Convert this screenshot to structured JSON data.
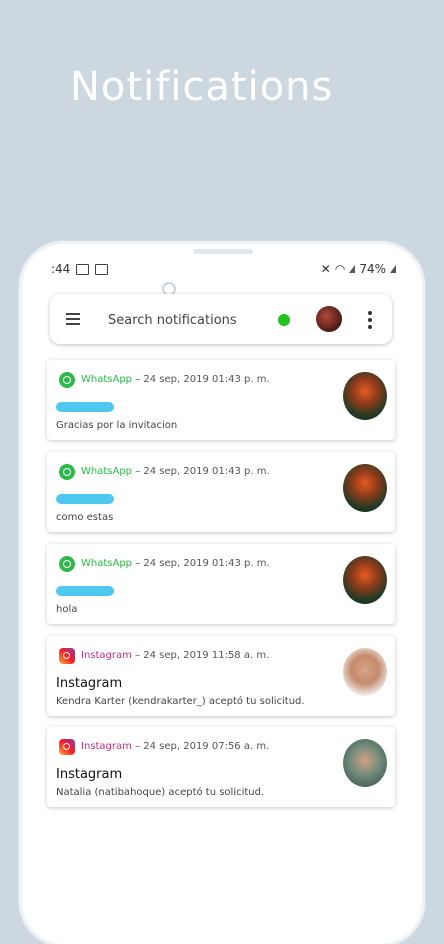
{
  "headline": "Notifications",
  "statusbar": {
    "time": ":44",
    "battery": "74%"
  },
  "search": {
    "placeholder": "Search notifications",
    "status_color": "#22c21f"
  },
  "notifications": [
    {
      "app": "WhatsApp",
      "app_color": "#2fb94c",
      "separator": "–",
      "time": "24 sep, 2019 01:43 p. m.",
      "message": "Gracias por la invitacion"
    },
    {
      "app": "WhatsApp",
      "app_color": "#2fb94c",
      "separator": "–",
      "time": "24 sep, 2019 01:43 p. m.",
      "message": "como estas"
    },
    {
      "app": "WhatsApp",
      "app_color": "#2fb94c",
      "separator": "–",
      "time": "24 sep, 2019 01:43 p. m.",
      "message": "hola"
    },
    {
      "app": "Instagram",
      "app_color": "#c13584",
      "separator": "–",
      "time": "24 sep, 2019 11:58 a. m.",
      "title": "Instagram",
      "message": "Kendra Karter (kendrakarter_) aceptó tu solicitud."
    },
    {
      "app": "Instagram",
      "app_color": "#c13584",
      "separator": "–",
      "time": "24 sep, 2019 07:56 a. m.",
      "title": "Instagram",
      "message": "Natalia (natibahoque) aceptó tu solicitud."
    }
  ],
  "icons": {
    "menu": "menu-icon",
    "more": "more-vertical-icon",
    "whatsapp": "whatsapp-icon",
    "instagram": "instagram-icon"
  }
}
